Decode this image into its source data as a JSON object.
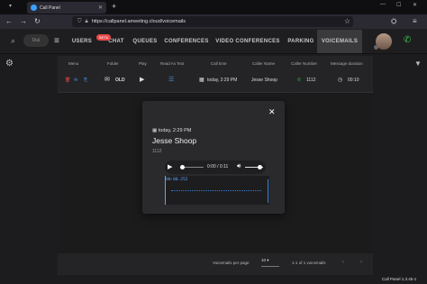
{
  "browser": {
    "tab_title": "Call Panel",
    "url": "https://callpanel.ameeting.cloud/voicemails"
  },
  "header": {
    "nav": [
      {
        "label": "USERS"
      },
      {
        "label": "CHAT",
        "badge": "BETA"
      },
      {
        "label": "QUEUES"
      },
      {
        "label": "CONFERENCES"
      },
      {
        "label": "VIDEO CONFERENCES"
      },
      {
        "label": "PARKING"
      },
      {
        "label": "VOICEMAILS",
        "active": true
      }
    ],
    "dial_placeholder": "Dial"
  },
  "table": {
    "columns": [
      "Menu",
      "Folder",
      "Play",
      "Read As Text",
      "Call time",
      "Caller Name",
      "Caller Number",
      "Message duration"
    ],
    "row": {
      "folder": "OLD",
      "call_time": "today, 2:29 PM",
      "caller_name": "Jesse Shoop",
      "caller_number": "1112",
      "duration": "00:10"
    }
  },
  "modal": {
    "date": "today, 2:29 PM",
    "caller_name": "Jesse Shoop",
    "caller_number": "1112",
    "player_time": "0:00 / 0:11",
    "progress": 0,
    "volume": 0.8,
    "wave_time": "00:00.252"
  },
  "footer": {
    "rows_label": "Voicemails per page",
    "rows_value": "10",
    "range": "1-1 of 1 voicemails"
  },
  "status": {
    "version": "Call Panel 1.3.45-1"
  },
  "colors": {
    "accent_blue": "#4b8fe0",
    "delete_red": "#e04848",
    "phone_green": "#3bbf4f",
    "beta_red": "#e84a4a"
  }
}
